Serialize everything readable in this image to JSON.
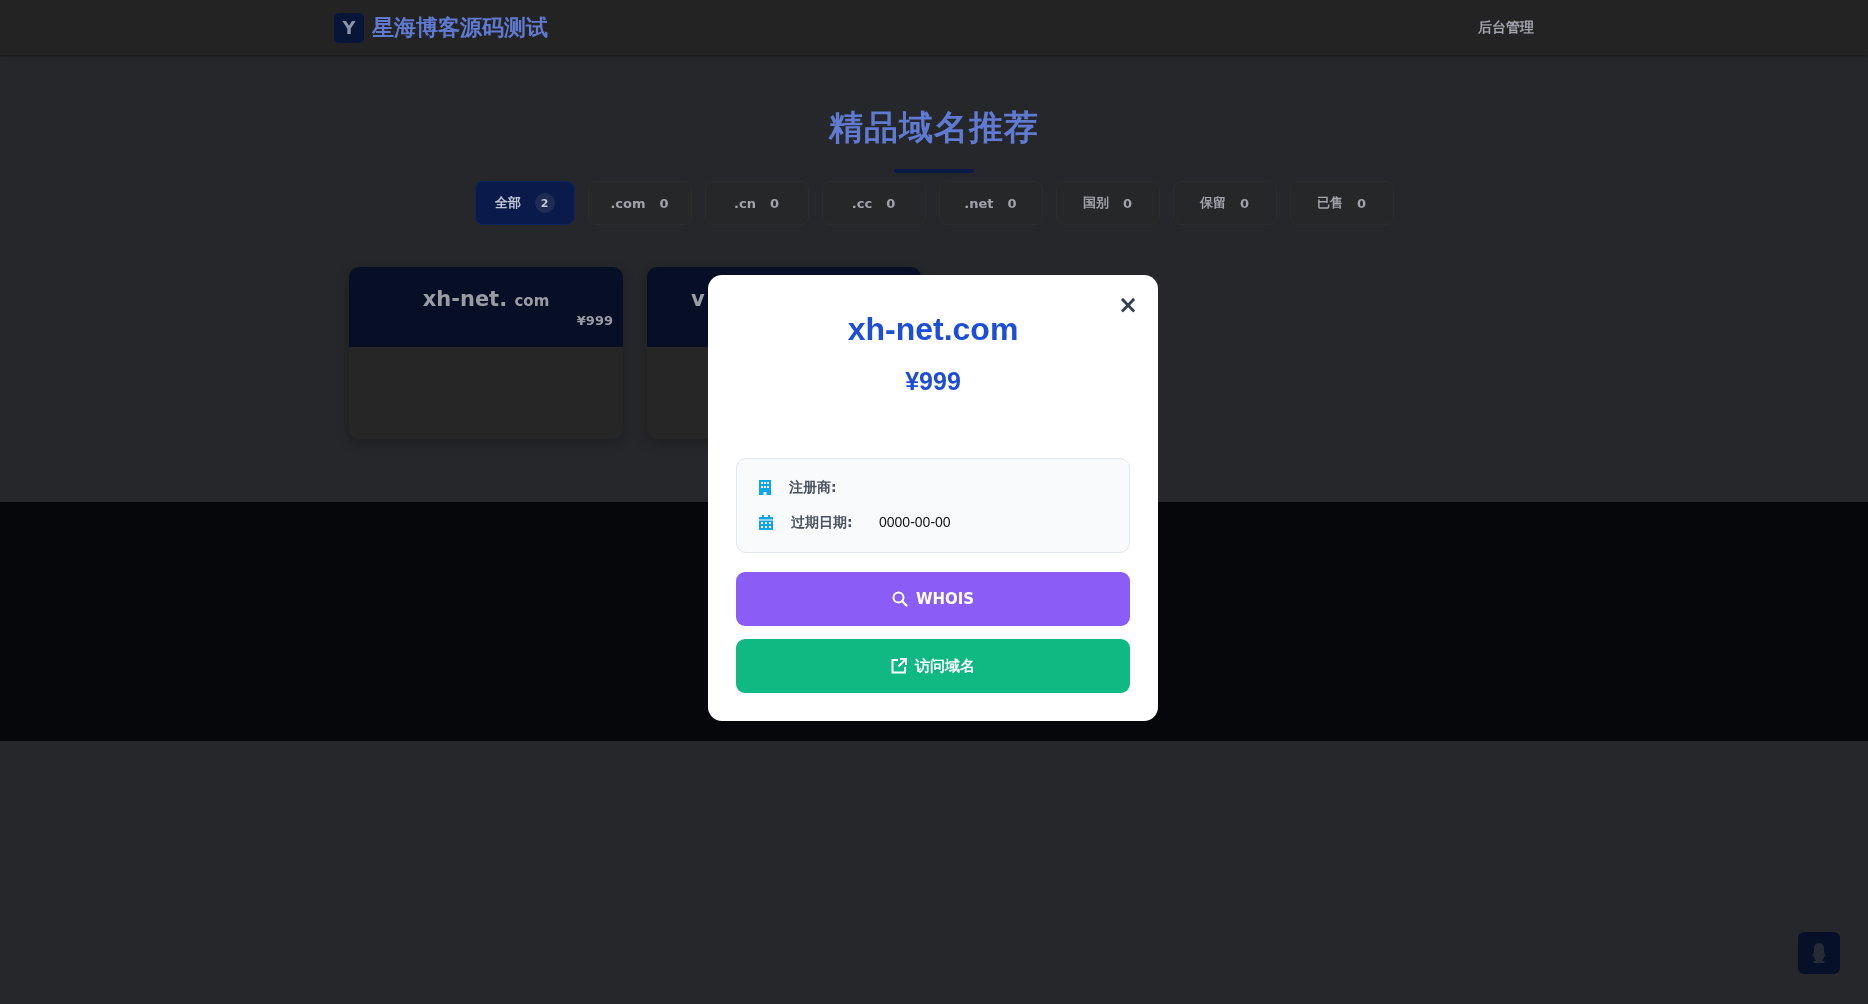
{
  "header": {
    "logo_letter": "Y",
    "site_title": "星海博客源码测试",
    "admin_link": "后台管理"
  },
  "section_title": "精品域名推荐",
  "filter_tabs": [
    {
      "label": "全部",
      "count": "2",
      "selected": true
    },
    {
      "label": ".com",
      "count": "0",
      "selected": false
    },
    {
      "label": ".cn",
      "count": "0",
      "selected": false
    },
    {
      "label": ".cc",
      "count": "0",
      "selected": false
    },
    {
      "label": ".net",
      "count": "0",
      "selected": false
    },
    {
      "label": "国别",
      "count": "0",
      "selected": false
    },
    {
      "label": "保留",
      "count": "0",
      "selected": false
    },
    {
      "label": "已售",
      "count": "0",
      "selected": false
    }
  ],
  "domain_cards": [
    {
      "name": "xh-net.",
      "tld": "com",
      "price": "¥999",
      "partial": false
    },
    {
      "name": "v",
      "partial": true
    }
  ],
  "modal": {
    "close": "×",
    "domain": "xh-net.com",
    "price": "¥999",
    "info": [
      {
        "kind": "registrar",
        "label": "注册商:"
      },
      {
        "kind": "expiry",
        "label": "过期日期:",
        "value": "0000-00-00"
      }
    ],
    "buttons": [
      {
        "kind": "whois",
        "label": "WHOIS"
      },
      {
        "kind": "visit",
        "label": "访问域名"
      }
    ]
  }
}
